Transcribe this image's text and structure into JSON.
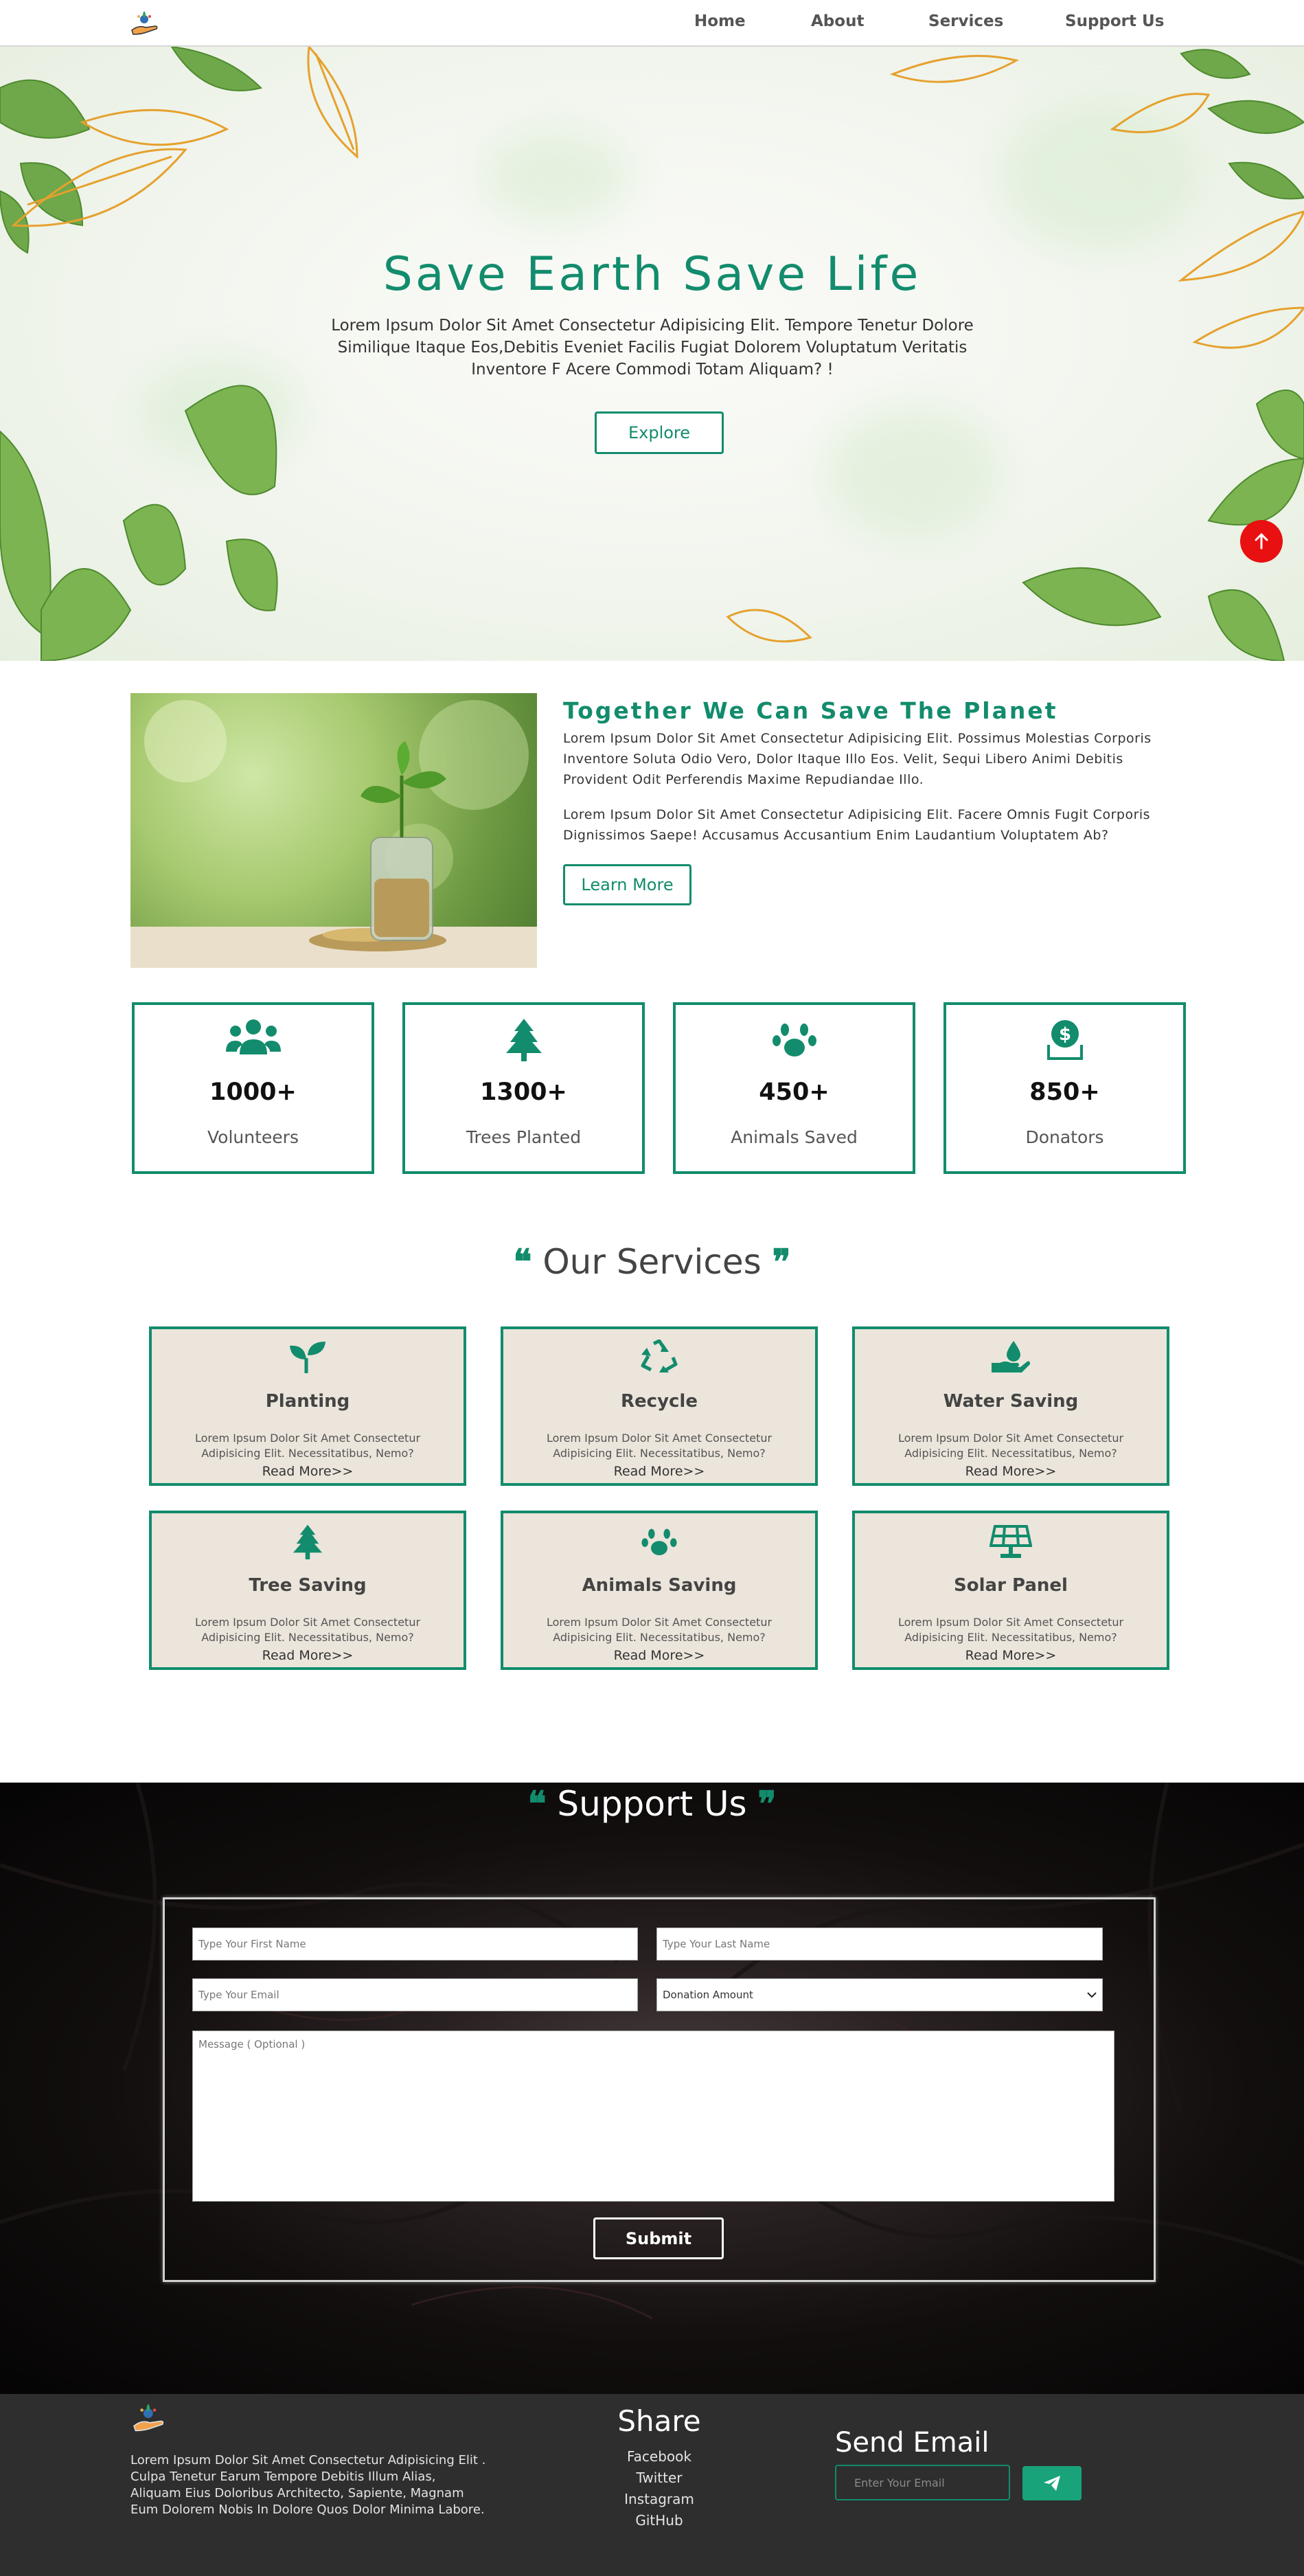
{
  "nav": {
    "links": [
      "Home",
      "About",
      "Services",
      "Support Us"
    ]
  },
  "hero": {
    "title": "Save Earth Save Life",
    "text": "Lorem Ipsum Dolor Sit Amet Consectetur Adipisicing Elit. Tempore Tenetur Dolore Similique Itaque Eos,Debitis Eveniet Facilis Fugiat Dolorem Voluptatum Veritatis Inventore F Acere Commodi Totam Aliquam? !",
    "button": "Explore"
  },
  "about": {
    "title": "Together We Can Save The Planet",
    "p1": "Lorem Ipsum Dolor Sit Amet Consectetur Adipisicing Elit. Possimus Molestias Corporis Inventore Soluta Odio Vero, Dolor Itaque Illo Eos. Velit, Sequi Libero Animi Debitis Provident Odit Perferendis Maxime Repudiandae Illo.",
    "p2": "Lorem Ipsum Dolor Sit Amet Consectetur Adipisicing Elit. Facere Omnis Fugit Corporis Dignissimos Saepe! Accusamus Accusantium Enim Laudantium Voluptatem Ab?",
    "button": "Learn More"
  },
  "stats": [
    {
      "icon": "users-icon",
      "number": "1000+",
      "label": "Volunteers"
    },
    {
      "icon": "tree-icon",
      "number": "1300+",
      "label": "Trees Planted"
    },
    {
      "icon": "paw-icon",
      "number": "450+",
      "label": "Animals Saved"
    },
    {
      "icon": "donate-icon",
      "number": "850+",
      "label": "Donators"
    }
  ],
  "services": {
    "open_quote": "❝",
    "title": "Our Services",
    "close_quote": "❞",
    "items": [
      {
        "icon": "seedling-icon",
        "name": "Planting",
        "desc": "Lorem Ipsum Dolor Sit Amet Consectetur Adipisicing Elit. Necessitatibus, Nemo?",
        "more": "Read More>>"
      },
      {
        "icon": "recycle-icon",
        "name": "Recycle",
        "desc": "Lorem Ipsum Dolor Sit Amet Consectetur Adipisicing Elit. Necessitatibus, Nemo?",
        "more": "Read More>>"
      },
      {
        "icon": "water-hand-icon",
        "name": "Water Saving",
        "desc": "Lorem Ipsum Dolor Sit Amet Consectetur Adipisicing Elit. Necessitatibus, Nemo?",
        "more": "Read More>>"
      },
      {
        "icon": "tree-icon",
        "name": "Tree Saving",
        "desc": "Lorem Ipsum Dolor Sit Amet Consectetur Adipisicing Elit. Necessitatibus, Nemo?",
        "more": "Read More>>"
      },
      {
        "icon": "paw-icon",
        "name": "Animals Saving",
        "desc": "Lorem Ipsum Dolor Sit Amet Consectetur Adipisicing Elit. Necessitatibus, Nemo?",
        "more": "Read More>>"
      },
      {
        "icon": "solar-panel-icon",
        "name": "Solar Panel",
        "desc": "Lorem Ipsum Dolor Sit Amet Consectetur Adipisicing Elit. Necessitatibus, Nemo?",
        "more": "Read More>>"
      }
    ]
  },
  "support": {
    "open_quote": "❝",
    "title": "Support Us",
    "close_quote": "❞",
    "first_name_placeholder": "Type Your First Name",
    "last_name_placeholder": "Type Your Last Name",
    "email_placeholder": "Type Your Email",
    "donation_selected": "Donation Amount",
    "message_placeholder": "Message ( Optional )",
    "submit": "Submit"
  },
  "footer": {
    "text": "Lorem Ipsum Dolor Sit Amet Consectetur Adipisicing Elit . Culpa Tenetur Earum Tempore Debitis Illum Alias, Aliquam Eius Doloribus Architecto, Sapiente, Magnam Eum Dolorem Nobis In Dolore Quos Dolor Minima Labore.",
    "share_title": "Share",
    "share_links": [
      "Facebook",
      "Twitter",
      "Instagram",
      "GitHub"
    ],
    "send_title": "Send Email",
    "email_placeholder": "Enter Your Email"
  },
  "colors": {
    "accent": "#128c6c",
    "scroll_top": "#e81010",
    "card_bg": "#ebe5db",
    "footer_bg": "#2e2e2e"
  }
}
